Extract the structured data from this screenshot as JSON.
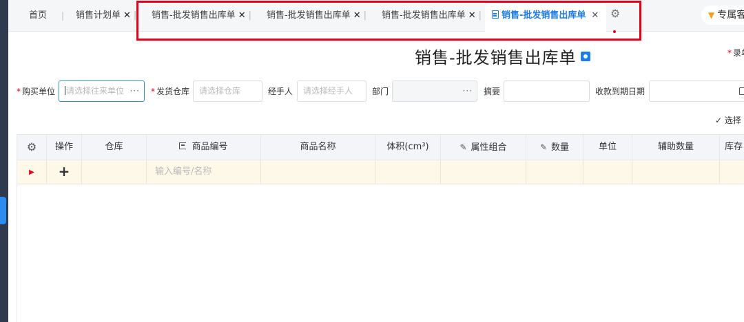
{
  "tabs": {
    "home": "首页",
    "items": [
      {
        "label": "销售计划单",
        "close": "✕"
      },
      {
        "label": "销售-批发销售出库单",
        "close": "✕"
      },
      {
        "label": "销售-批发销售出库单",
        "close": "✕"
      },
      {
        "label": "销售-批发销售出库单",
        "close": "✕"
      }
    ],
    "active": {
      "label": "销售-批发销售出库单",
      "close": "✕"
    },
    "right_label": "专属客"
  },
  "page": {
    "title": "销售-批发销售出库单",
    "right_label": "录单"
  },
  "form": {
    "buyer": {
      "label": "购买单位",
      "placeholder": "请选择往来单位"
    },
    "warehouse": {
      "label": "发货仓库",
      "placeholder": "请选择仓库"
    },
    "handler": {
      "label": "经手人",
      "placeholder": "请选择经手人"
    },
    "department": {
      "label": "部门"
    },
    "summary": {
      "label": "摘要"
    },
    "due_date": {
      "label": "收款到期日期"
    },
    "select_option": "选择"
  },
  "table": {
    "headers": [
      "操作",
      "仓库",
      "商品编号",
      "商品名称",
      "体积(cm³)",
      "属性组合",
      "数量",
      "单位",
      "辅助数量",
      "库存"
    ],
    "row_placeholder": "输入编号/名称"
  },
  "colors": {
    "accent": "#1e7ce8",
    "highlight": "#e3001b",
    "row_bg": "#fdf8e8"
  },
  "icons": [
    "gear-icon",
    "close-icon",
    "document-icon",
    "crown-icon",
    "settings-icon",
    "calendar-icon",
    "play-icon",
    "plus-icon",
    "pencil-icon",
    "bracket-icon"
  ]
}
